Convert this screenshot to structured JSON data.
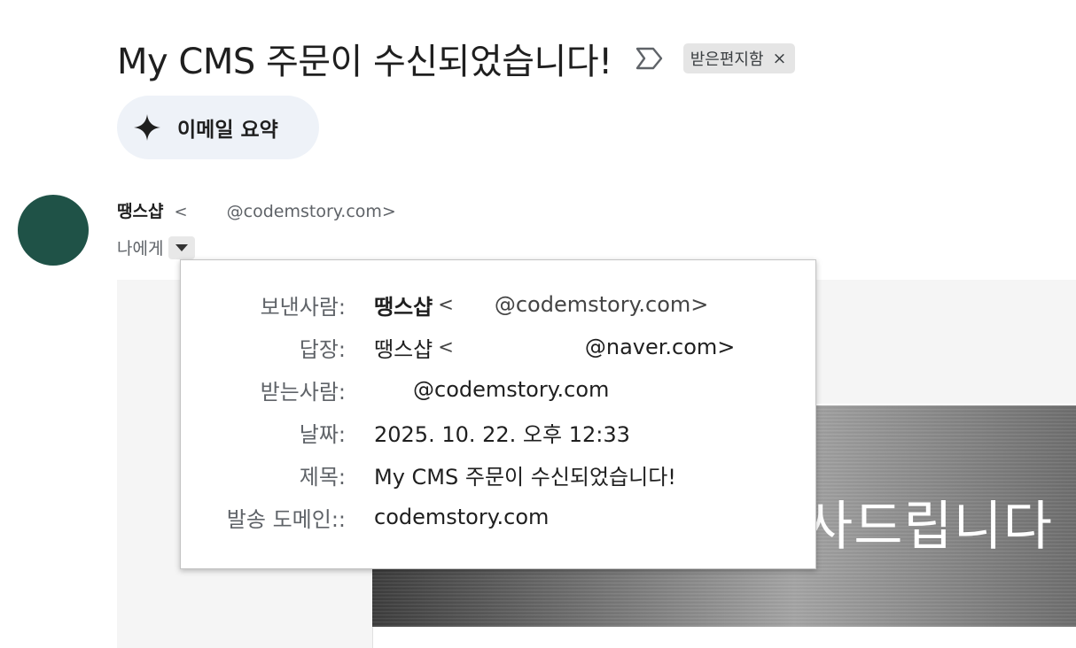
{
  "email": {
    "subject": "My CMS 주문이 수신되었습니다!",
    "label_chip": "받은편지함",
    "label_remove": "×",
    "summary_button": "이메일 요약",
    "sender_name": "땡스샵",
    "sender_lt": "<",
    "sender_email": "@codemstory.com>",
    "to_me": "나에게",
    "banner_text": "사드립니다"
  },
  "details": {
    "from_label": "보낸사람:",
    "from_name": "땡스샵",
    "from_lt": "<",
    "from_email": "@codemstory.com>",
    "reply_label": "답장:",
    "reply_name": "땡스샵",
    "reply_lt": "<",
    "reply_email": "@naver.com>",
    "to_label": "받는사람:",
    "to_email": "@codemstory.com",
    "date_label": "날짜:",
    "date_value": "2025. 10. 22. 오후 12:33",
    "subject_label": "제목:",
    "subject_value": "My CMS 주문이 수신되었습니다!",
    "domain_label": "발송 도메인::",
    "domain_value": "codemstory.com"
  },
  "icons": {
    "important": "important-marker-icon",
    "sparkle": "sparkle-icon",
    "caret": "caret-down-icon"
  },
  "colors": {
    "avatar": "#1f5247",
    "summary_bg": "#eef2f8",
    "chip_bg": "#e5e5e5"
  }
}
